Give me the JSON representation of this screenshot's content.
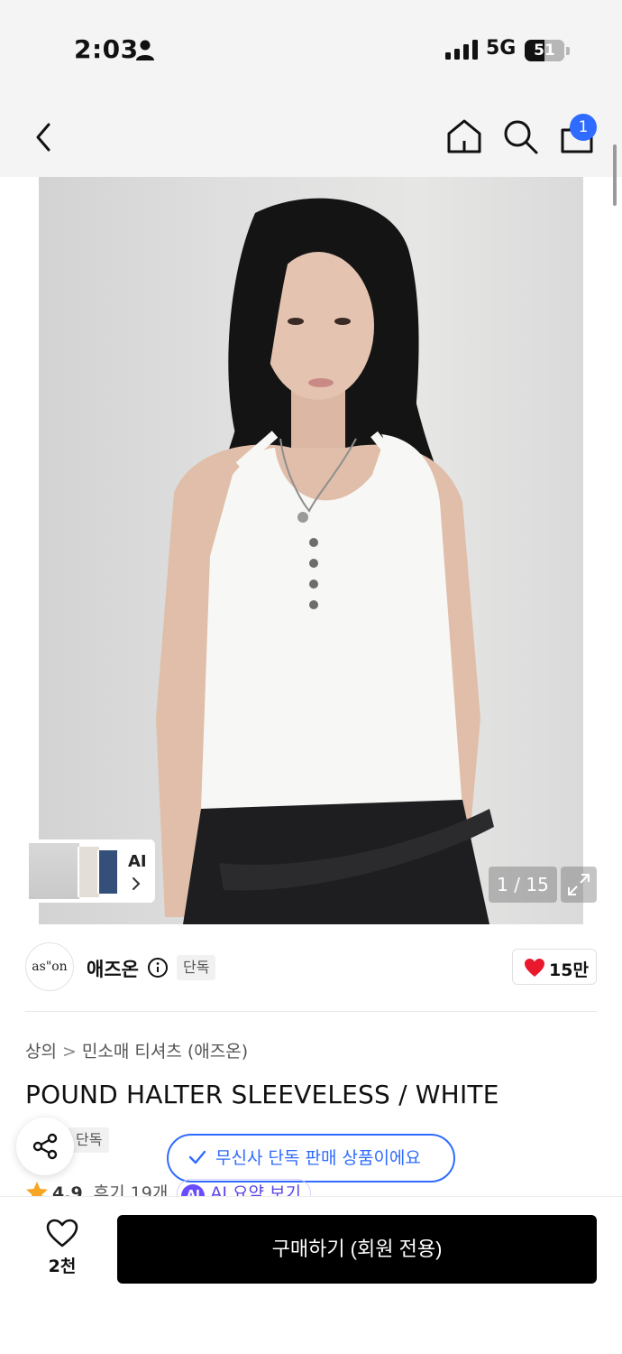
{
  "status_bar": {
    "time": "2:03",
    "network": "5G",
    "battery": "51"
  },
  "nav": {
    "cart_count": "1"
  },
  "gallery": {
    "ai_label": "AI",
    "counter": "1 / 15"
  },
  "brand": {
    "logo_text": "as\"on",
    "name": "애즈온",
    "exclusive_tag": "단독",
    "likes": "15만"
  },
  "breadcrumb": {
    "category": "상의",
    "subcategory": "민소매 티셔츠 (애즈온)"
  },
  "product": {
    "title": "POUND HALTER SLEEVELESS / WHITE",
    "tag": "단독"
  },
  "banner": {
    "text": "무신사 단독 판매 상품이에요"
  },
  "rating": {
    "value": "4.9",
    "reviews": "후기 19개",
    "ai_badge": "AI",
    "ai_summary": "AI 요약 보기"
  },
  "bottom_bar": {
    "wish_count": "2천",
    "buy_label": "구매하기 (회원 전용)"
  },
  "colors": {
    "accent": "#2f6bff",
    "heart": "#e8192c",
    "buy_button": "#000000"
  }
}
